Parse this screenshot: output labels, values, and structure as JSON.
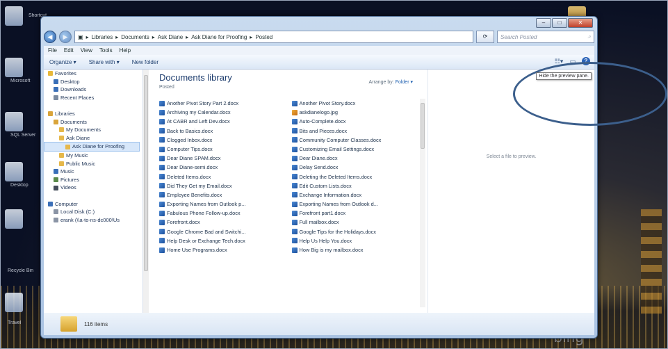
{
  "window": {
    "address_crumbs": [
      "Libraries",
      "Documents",
      "Ask Diane",
      "Ask Diane for Proofing",
      "Posted"
    ],
    "address_sep": "▸",
    "search_placeholder": "Search Posted",
    "controls": {
      "minimize": "–",
      "maximize": "□",
      "close": "✕"
    }
  },
  "menu": [
    "File",
    "Edit",
    "View",
    "Tools",
    "Help"
  ],
  "toolbar": {
    "organize": "Organize ▾",
    "share": "Share with ▾",
    "new_folder": "New folder",
    "tooltip": "Hide the preview pane."
  },
  "nav": [
    {
      "label": "Favorites",
      "level": 0,
      "icon": "star-icon",
      "color": "#e8b83a"
    },
    {
      "label": "Desktop",
      "level": 1,
      "icon": "desktop-icon",
      "color": "#3a6fb8"
    },
    {
      "label": "Downloads",
      "level": 1,
      "icon": "download-icon",
      "color": "#3a6fb8"
    },
    {
      "label": "Recent Places",
      "level": 1,
      "icon": "recent-icon",
      "color": "#7a8aa0"
    },
    {
      "label": "",
      "level": 0,
      "icon": "",
      "color": ""
    },
    {
      "label": "Libraries",
      "level": 0,
      "icon": "library-icon",
      "color": "#d9a43a"
    },
    {
      "label": "Documents",
      "level": 1,
      "icon": "documents-icon",
      "color": "#d9a43a"
    },
    {
      "label": "My Documents",
      "level": 2,
      "icon": "folder-icon",
      "color": "#e6b84a"
    },
    {
      "label": "Ask Diane",
      "level": 2,
      "icon": "folder-icon",
      "color": "#e6b84a"
    },
    {
      "label": "Ask Diane for Proofing",
      "level": 3,
      "icon": "folder-icon",
      "color": "#e6b84a",
      "selected": true
    },
    {
      "label": "My Music",
      "level": 2,
      "icon": "folder-icon",
      "color": "#e6b84a"
    },
    {
      "label": "Public Music",
      "level": 2,
      "icon": "folder-icon",
      "color": "#e6b84a"
    },
    {
      "label": "Music",
      "level": 1,
      "icon": "music-icon",
      "color": "#3a6fb8"
    },
    {
      "label": "Pictures",
      "level": 1,
      "icon": "pictures-icon",
      "color": "#5a8a4a"
    },
    {
      "label": "Videos",
      "level": 1,
      "icon": "videos-icon",
      "color": "#444c5a"
    },
    {
      "label": "",
      "level": 0,
      "icon": "",
      "color": ""
    },
    {
      "label": "Computer",
      "level": 0,
      "icon": "computer-icon",
      "color": "#3a6fb8"
    },
    {
      "label": "Local Disk (C:)",
      "level": 1,
      "icon": "disk-icon",
      "color": "#8a94a5"
    },
    {
      "label": "erank (\\\\a-to-ns-dc000\\Us",
      "level": 1,
      "icon": "network-drive-icon",
      "color": "#8a94a5"
    }
  ],
  "library": {
    "title": "Documents library",
    "subtitle": "Posted",
    "arrange_label": "Arrange by:",
    "arrange_value": "Folder ▾"
  },
  "files": [
    {
      "name": "Another Pivot Story Part 2.docx",
      "type": "doc"
    },
    {
      "name": "Another Pivot Story.docx",
      "type": "doc"
    },
    {
      "name": "Archiving my Calendar.docx",
      "type": "doc"
    },
    {
      "name": "askdianelogo.jpg",
      "type": "img"
    },
    {
      "name": "At CABR and Left Dev.docx",
      "type": "doc"
    },
    {
      "name": "Auto-Complete.docx",
      "type": "doc"
    },
    {
      "name": "Back to Basics.docx",
      "type": "doc"
    },
    {
      "name": "Bits and Pieces.docx",
      "type": "doc"
    },
    {
      "name": "Clogged Inbox.docx",
      "type": "doc"
    },
    {
      "name": "Community Computer Classes.docx",
      "type": "doc"
    },
    {
      "name": "Computer Tips.docx",
      "type": "doc"
    },
    {
      "name": "Customizing Email Settings.docx",
      "type": "doc"
    },
    {
      "name": "Dear Diane SPAM.docx",
      "type": "doc"
    },
    {
      "name": "Dear Diane.docx",
      "type": "doc"
    },
    {
      "name": "Dear Diane-semi.docx",
      "type": "doc"
    },
    {
      "name": "Delay Send.docx",
      "type": "doc"
    },
    {
      "name": "Deleted Items.docx",
      "type": "doc"
    },
    {
      "name": "Deleting the Deleted Items.docx",
      "type": "doc"
    },
    {
      "name": "Did They Get my Email.docx",
      "type": "doc"
    },
    {
      "name": "Edit Custom Lists.docx",
      "type": "doc"
    },
    {
      "name": "Employee Benefits.docx",
      "type": "doc"
    },
    {
      "name": "Exchange Information.docx",
      "type": "doc"
    },
    {
      "name": "Exporting Names from Outlook p...",
      "type": "doc"
    },
    {
      "name": "Exporting Names from Outlook d...",
      "type": "doc"
    },
    {
      "name": "Fabulous Phone Follow-up.docx",
      "type": "doc"
    },
    {
      "name": "Forefront part1.docx",
      "type": "doc"
    },
    {
      "name": "Forefront.docx",
      "type": "doc"
    },
    {
      "name": "Full mailbox.docx",
      "type": "doc"
    },
    {
      "name": "Google Chrome Bad and Switchi...",
      "type": "doc"
    },
    {
      "name": "Google Tips for the Holidays.docx",
      "type": "doc"
    },
    {
      "name": "Help Desk or Exchange Tech.docx",
      "type": "doc"
    },
    {
      "name": "Help Us Help You.docx",
      "type": "doc"
    },
    {
      "name": "Home Use Programs.docx",
      "type": "doc"
    },
    {
      "name": "How Big is my mailbox.docx",
      "type": "doc"
    }
  ],
  "preview": {
    "message": "Select a file to preview."
  },
  "status": {
    "item_count": "116 items"
  },
  "desktop": {
    "left_labels": [
      "Shortcut",
      "Microsoft",
      "SQL Server",
      "Desktop",
      "Recycle Bin",
      "Travel"
    ],
    "wallpaper_brand": "bing"
  }
}
